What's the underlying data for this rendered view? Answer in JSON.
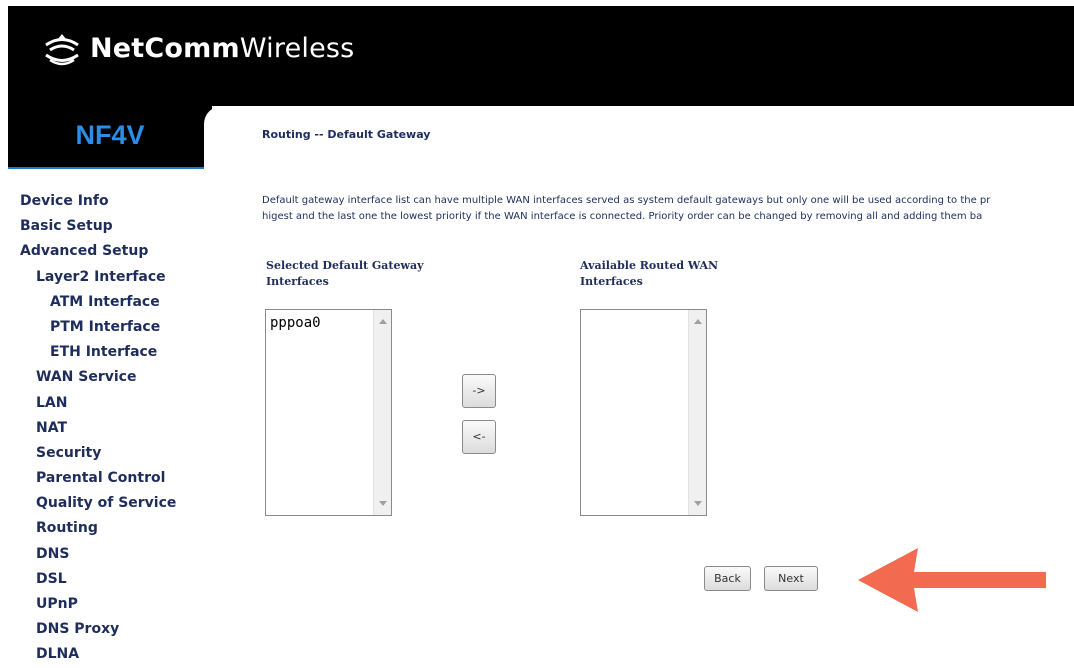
{
  "brand": {
    "logo_bold": "NetComm",
    "logo_light": "Wireless",
    "model": "NF4V"
  },
  "sidebar": {
    "items": [
      {
        "label": "Device Info"
      },
      {
        "label": "Basic Setup"
      },
      {
        "label": "Advanced Setup"
      },
      {
        "label": "Layer2 Interface"
      },
      {
        "label": "ATM Interface"
      },
      {
        "label": "PTM Interface"
      },
      {
        "label": "ETH Interface"
      },
      {
        "label": "WAN Service"
      },
      {
        "label": "LAN"
      },
      {
        "label": "NAT"
      },
      {
        "label": "Security"
      },
      {
        "label": "Parental Control"
      },
      {
        "label": "Quality of Service"
      },
      {
        "label": "Routing"
      },
      {
        "label": "DNS"
      },
      {
        "label": "DSL"
      },
      {
        "label": "UPnP"
      },
      {
        "label": "DNS Proxy"
      },
      {
        "label": "DLNA"
      }
    ]
  },
  "main": {
    "title": "Routing -- Default Gateway",
    "description_line1": "Default gateway interface list can have multiple WAN interfaces served as system default gateways but only one will be used according to the pr",
    "description_line2": "higest and the last one the lowest priority if the WAN interface is connected. Priority order can be changed by removing all and adding them ba",
    "selected_label_line1": "Selected Default Gateway",
    "selected_label_line2": "Interfaces",
    "available_label_line1": "Available Routed WAN",
    "available_label_line2": "Interfaces",
    "selected_items": [
      "pppoa0"
    ],
    "move_right_label": "->",
    "move_left_label": "<-",
    "back_label": "Back",
    "next_label": "Next"
  },
  "colors": {
    "header_bg": "#000000",
    "model_color": "#2a8ee6",
    "nav_text": "#1e2d5c",
    "annotation_arrow": "#f26a50"
  }
}
